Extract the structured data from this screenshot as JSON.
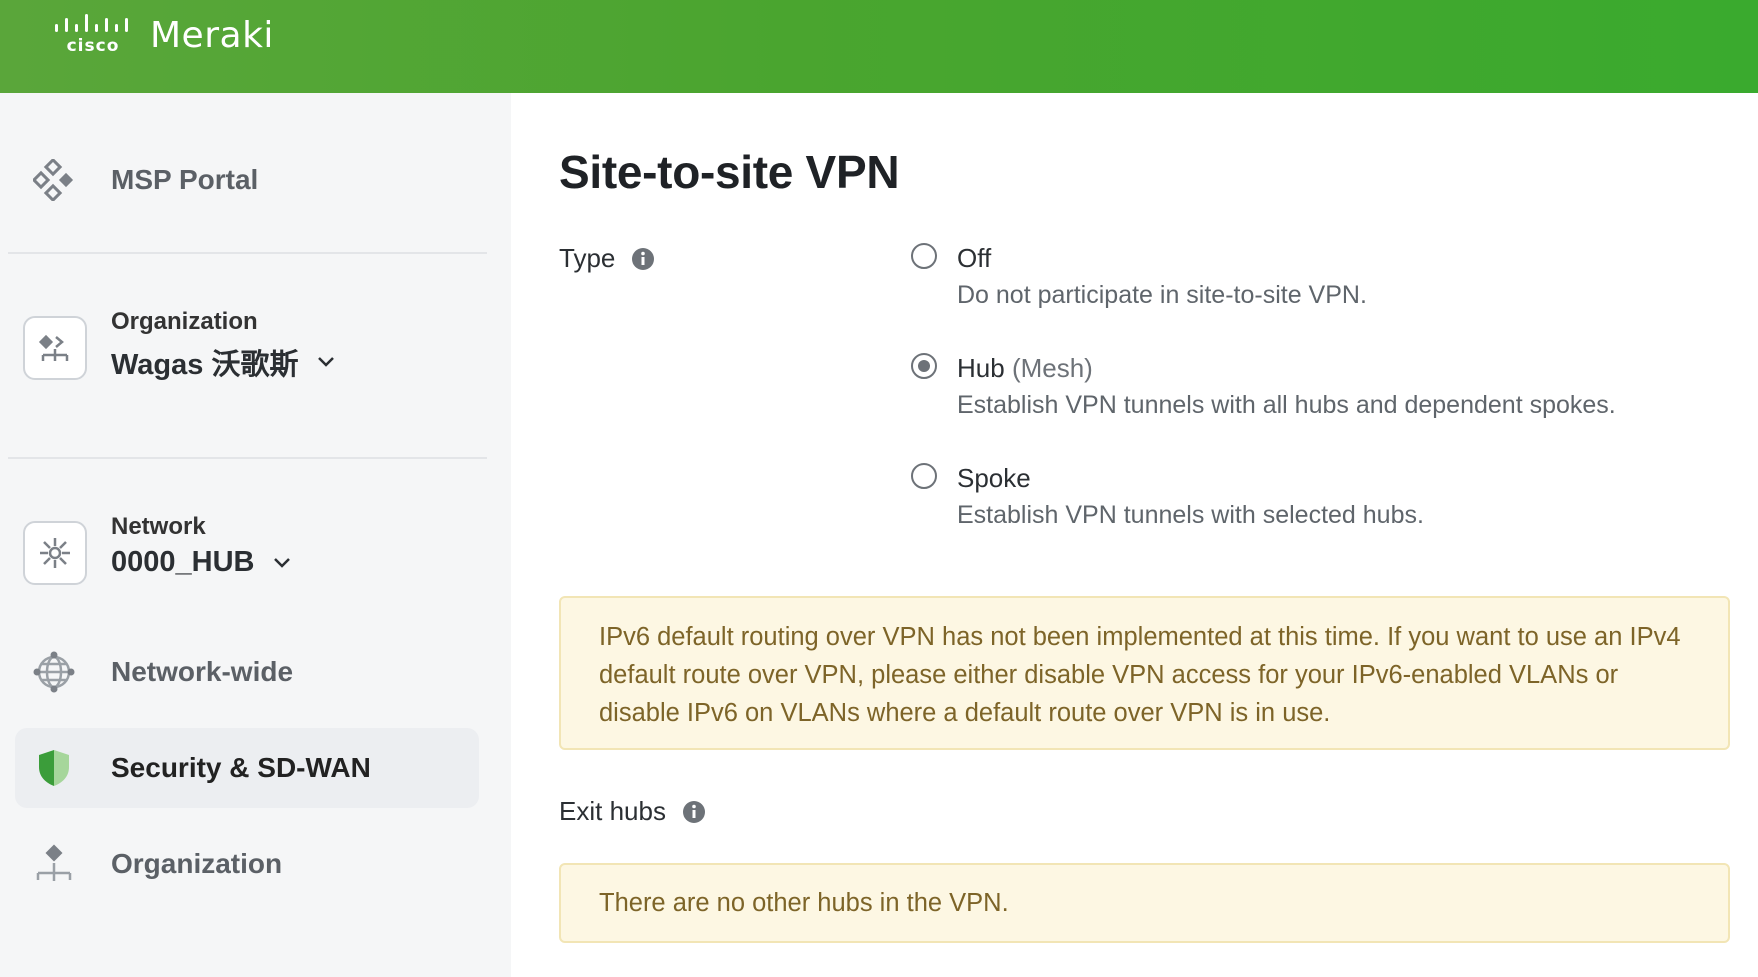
{
  "header": {
    "brand_company": "cisco",
    "brand_product": "Meraki",
    "bg_color": "#4aa52f"
  },
  "sidebar": {
    "msp_portal": "MSP Portal",
    "organization": {
      "label": "Organization",
      "value": "Wagas 沃歌斯"
    },
    "network": {
      "label": "Network",
      "value": "0000_HUB"
    },
    "items": [
      {
        "label": "Network-wide",
        "icon": "globe-icon",
        "active": false
      },
      {
        "label": "Security & SD-WAN",
        "icon": "shield-icon",
        "active": true
      },
      {
        "label": "Organization",
        "icon": "organization-icon",
        "active": false
      }
    ]
  },
  "main": {
    "title": "Site-to-site VPN",
    "type_label": "Type",
    "options": [
      {
        "title": "Off",
        "subtitle": "",
        "description": "Do not participate in site-to-site VPN.",
        "checked": false
      },
      {
        "title": "Hub",
        "subtitle": "(Mesh)",
        "description": "Establish VPN tunnels with all hubs and dependent spokes.",
        "checked": true
      },
      {
        "title": "Spoke",
        "subtitle": "",
        "description": "Establish VPN tunnels with selected hubs.",
        "checked": false
      }
    ],
    "ipv6_notice": "IPv6 default routing over VPN has not been implemented at this time. If you want to use an IPv4 default route over VPN, please either disable VPN access for your IPv6-enabled VLANs or disable IPv6 on VLANs where a default route over VPN is in use.",
    "exit_hubs_label": "Exit hubs",
    "exit_hubs_notice": "There are no other hubs in the VPN.",
    "notice_bg": "#fdf7e3",
    "notice_text_color": "#7d6428"
  }
}
